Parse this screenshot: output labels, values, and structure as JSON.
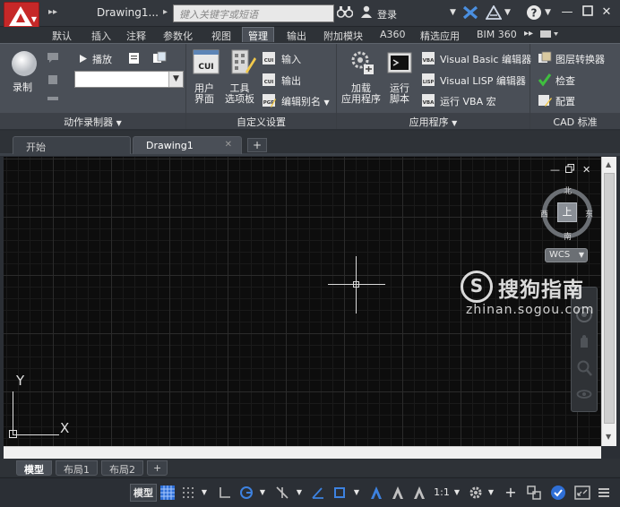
{
  "title_bar": {
    "doc_title": "Drawing1...",
    "search_placeholder": "键入关键字或短语",
    "login_label": "登录",
    "help_label": "?"
  },
  "ribbon_tabs": [
    {
      "label": "默认"
    },
    {
      "label": "插入"
    },
    {
      "label": "注释"
    },
    {
      "label": "参数化"
    },
    {
      "label": "视图"
    },
    {
      "label": "管理",
      "active": true
    },
    {
      "label": "输出"
    },
    {
      "label": "附加模块"
    },
    {
      "label": "A360"
    },
    {
      "label": "精选应用"
    },
    {
      "label": "BIM 360"
    }
  ],
  "panels": {
    "action_recorder": {
      "title": "动作录制器",
      "record_label": "录制",
      "play_label": "播放"
    },
    "customization": {
      "title": "自定义设置",
      "user_interface_label_1": "用户",
      "user_interface_label_2": "界面",
      "tool_palettes_label_1": "工具",
      "tool_palettes_label_2": "选项板",
      "import_label": "输入",
      "export_label": "输出",
      "edit_alias_label": "编辑别名"
    },
    "applications": {
      "title": "应用程序",
      "load_app_label_1": "加载",
      "load_app_label_2": "应用程序",
      "run_script_label_1": "运行",
      "run_script_label_2": "脚本",
      "vb_editor_label": "Visual Basic 编辑器",
      "lisp_editor_label": "Visual LISP 编辑器",
      "run_vba_label": "运行 VBA 宏"
    },
    "cad_standards": {
      "title": "CAD 标准",
      "layer_translator_label": "图层转换器",
      "check_label": "检查",
      "configure_label": "配置"
    }
  },
  "icons": {
    "cui": "CUI",
    "cui_import": "CUI",
    "cui_export": "CUI",
    "pgp": "PGP",
    "vba": "VBA",
    "lisp": "LISP"
  },
  "doc_tabs": [
    {
      "label": "开始",
      "active": false
    },
    {
      "label": "Drawing1",
      "active": true
    }
  ],
  "viewport": {
    "compass_north": "北",
    "compass_south": "南",
    "compass_east": "东",
    "compass_west": "西",
    "cube_face": "上",
    "wcs_label": "WCS",
    "ucs_x": "X",
    "ucs_y": "Y"
  },
  "layout_tabs": [
    {
      "label": "模型",
      "active": true
    },
    {
      "label": "布局1",
      "active": false
    },
    {
      "label": "布局2",
      "active": false
    }
  ],
  "status_bar": {
    "model_label": "模型",
    "scale_label": "1:1"
  },
  "watermark": {
    "logo_char": "S",
    "text": "搜狗指南",
    "url": "zhinan.sogou.com"
  }
}
